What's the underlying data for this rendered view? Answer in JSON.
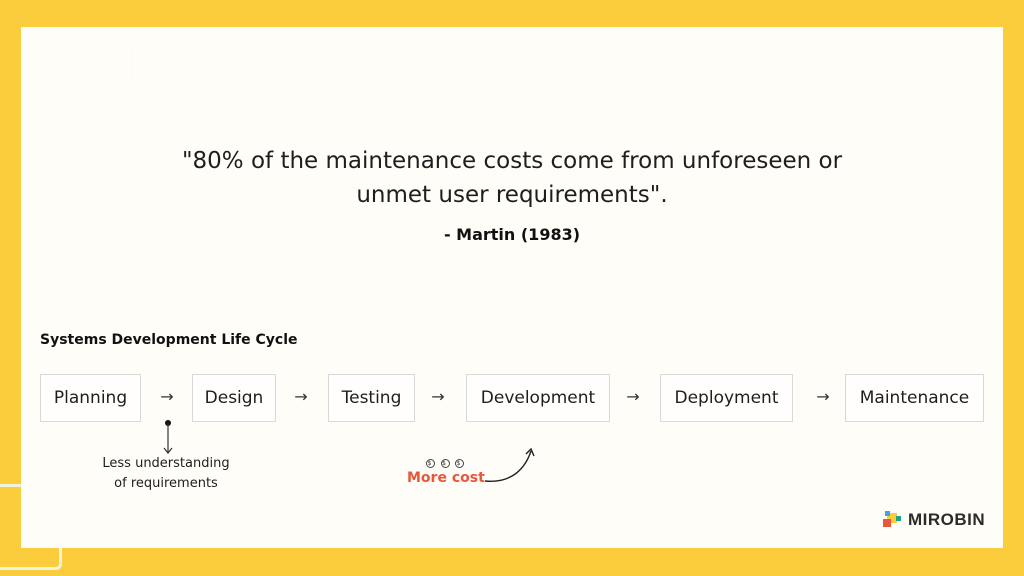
{
  "quote": {
    "line1": "\"80% of the maintenance costs come from unforeseen or",
    "line2": "unmet user requirements\".",
    "author": "- Martin (1983)"
  },
  "sdlc": {
    "title": "Systems Development Life Cycle",
    "steps": [
      {
        "label": "Planning"
      },
      {
        "label": "Design"
      },
      {
        "label": "Testing"
      },
      {
        "label": "Development"
      },
      {
        "label": "Deployment"
      },
      {
        "label": "Maintenance"
      }
    ],
    "arrow_glyph": "→",
    "annotations": {
      "planning_note_line1": "Less understanding",
      "planning_note_line2": "of requirements",
      "cost_symbols": "$",
      "cost_label": "More cost"
    }
  },
  "brand": {
    "name": "MIROBIN",
    "colors": {
      "frame": "#fbcd3d",
      "panel": "#fffdf8",
      "cost_accent": "#e8573c",
      "logo_red": "#e8573c",
      "logo_blue": "#4a9fe0",
      "logo_green": "#1aa58a",
      "logo_yellow": "#fbcd3d"
    }
  }
}
